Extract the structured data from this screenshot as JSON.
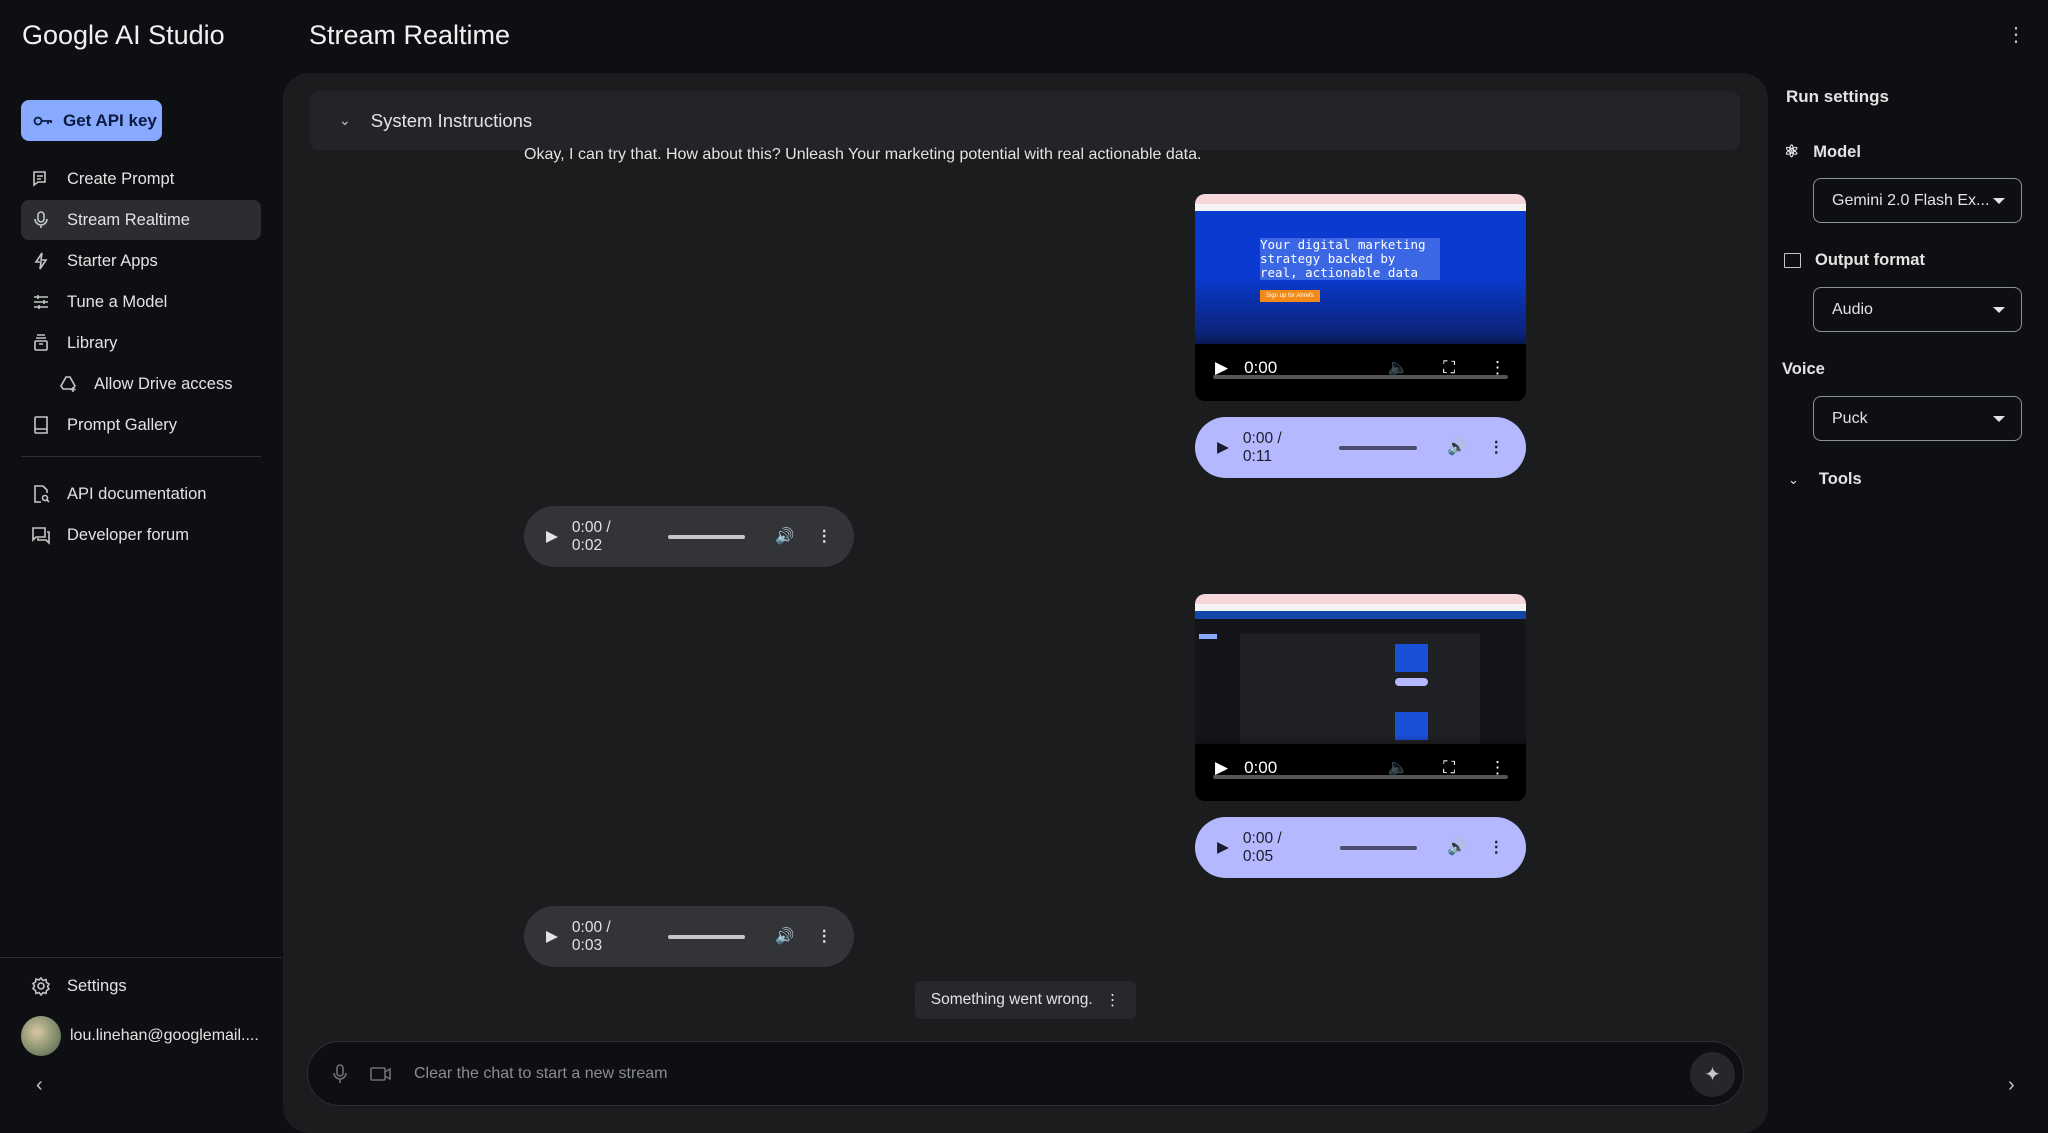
{
  "app": {
    "brand": "Google AI Studio",
    "page_title": "Stream Realtime"
  },
  "sidebar": {
    "api_key": "Get API key",
    "items": [
      {
        "label": "Create Prompt",
        "icon": "create-prompt-icon"
      },
      {
        "label": "Stream Realtime",
        "icon": "mic-icon",
        "active": true
      },
      {
        "label": "Starter Apps",
        "icon": "bolt-icon"
      },
      {
        "label": "Tune a Model",
        "icon": "tune-icon"
      },
      {
        "label": "Library",
        "icon": "library-icon"
      },
      {
        "label": "Allow Drive access",
        "icon": "drive-add-icon"
      },
      {
        "label": "Prompt Gallery",
        "icon": "book-icon"
      },
      {
        "label": "API documentation",
        "icon": "doc-search-icon"
      },
      {
        "label": "Developer forum",
        "icon": "forum-icon"
      }
    ],
    "settings": "Settings",
    "user_email": "lou.linehan@googlemail...."
  },
  "chat": {
    "system_instructions": "System Instructions",
    "model_message": "Okay, I can try that. How about this? Unleash Your marketing potential with real actionable data.",
    "video1": {
      "time": "0:00",
      "headline": "Your digital marketing strategy backed by real, actionable data",
      "cta": "Sign up for Ahrefs"
    },
    "user_audio1": {
      "time": "0:00 / 0:11"
    },
    "model_audio1": {
      "time": "0:00 / 0:02"
    },
    "video2": {
      "time": "0:00"
    },
    "user_audio2": {
      "time": "0:00 / 0:05"
    },
    "model_audio2": {
      "time": "0:00 / 0:03"
    },
    "error": "Something went wrong.",
    "input_placeholder": "Clear the chat to start a new stream"
  },
  "run_settings": {
    "title": "Run settings",
    "model_label": "Model",
    "model_value": "Gemini 2.0 Flash Ex...",
    "output_label": "Output format",
    "output_value": "Audio",
    "voice_label": "Voice",
    "voice_value": "Puck",
    "tools_label": "Tools"
  },
  "colors": {
    "accent": "#87a9ff",
    "user_audio": "#b4b8ff",
    "bg": "#0e0f12",
    "panel": "#1b1c1e"
  }
}
